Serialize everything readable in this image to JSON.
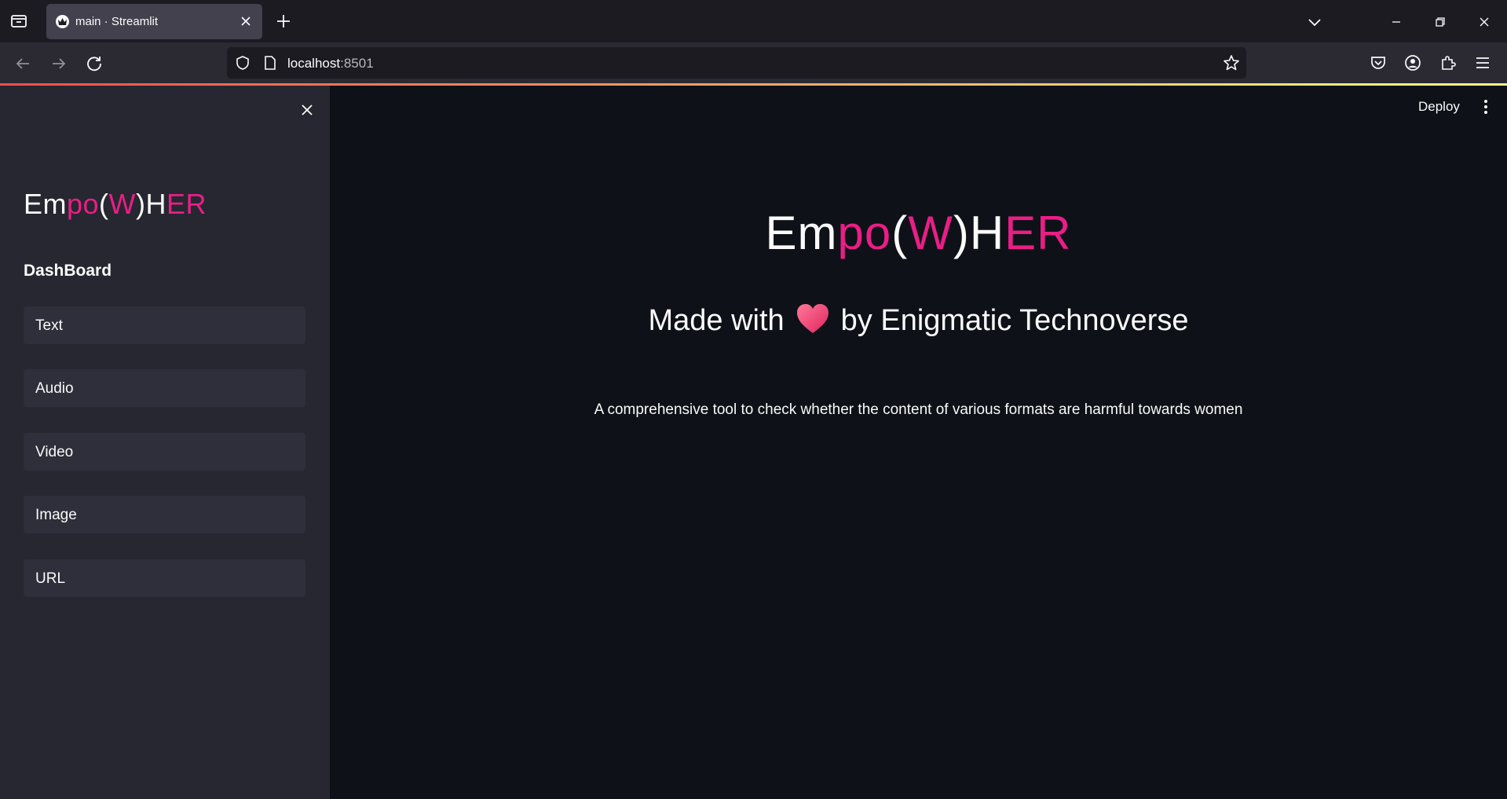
{
  "browser": {
    "tab_title": "main · Streamlit",
    "url_host": "localhost",
    "url_port": ":8501"
  },
  "sidebar": {
    "logo": {
      "part1": "Em",
      "part2": "po",
      "part3": "(",
      "part4": "W",
      "part5": ")H",
      "part6": "ER"
    },
    "heading": "DashBoard",
    "items": [
      {
        "label": "Text"
      },
      {
        "label": "Audio"
      },
      {
        "label": "Video"
      },
      {
        "label": "Image"
      },
      {
        "label": "URL"
      }
    ]
  },
  "header": {
    "deploy_label": "Deploy"
  },
  "main": {
    "logo": {
      "part1": "Em",
      "part2": "po",
      "part3": "(",
      "part4": "W",
      "part5": ")H",
      "part6": "ER"
    },
    "made_with_prefix": "Made with",
    "made_with_suffix": "by Enigmatic Technoverse",
    "tagline": "A comprehensive tool to check whether the content of various formats are harmful towards women"
  },
  "colors": {
    "accent_pink": "#e91e86",
    "sidebar_bg": "#262730",
    "main_bg": "#0e1117",
    "heart": "heart-icon"
  }
}
